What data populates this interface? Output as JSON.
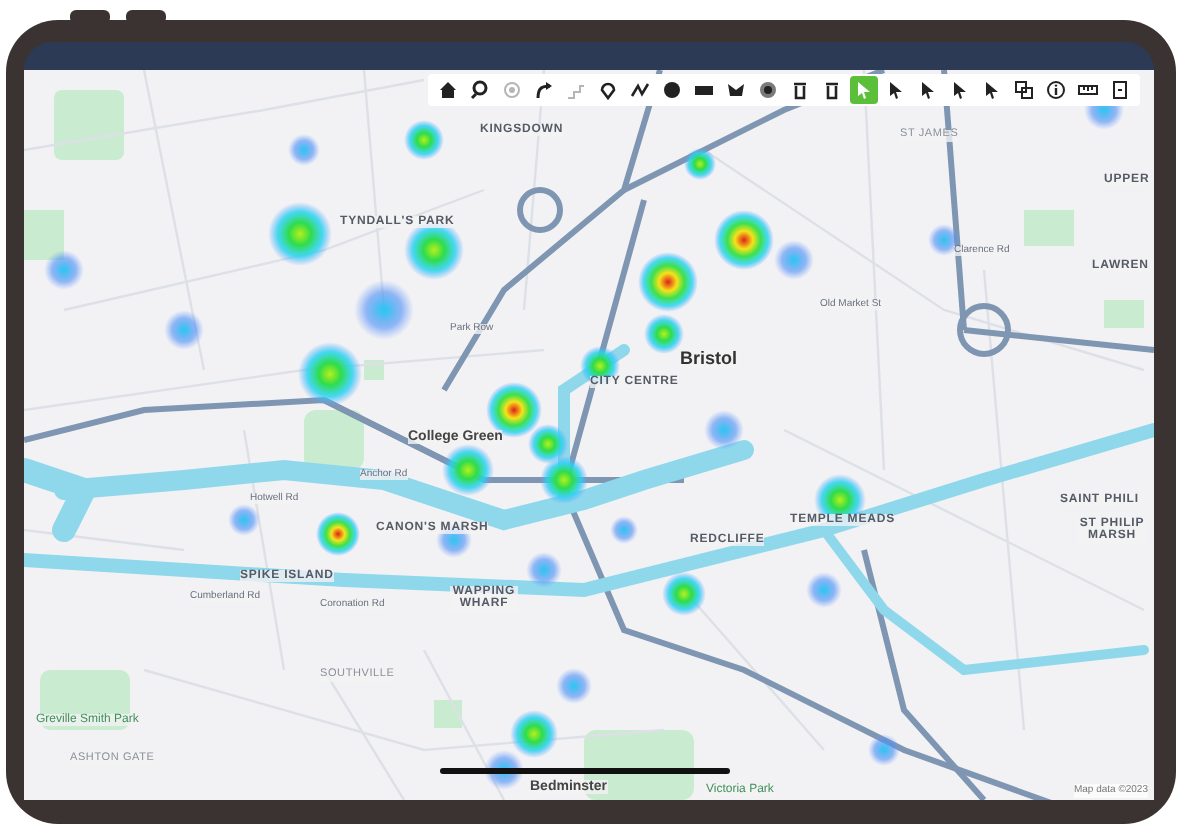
{
  "toolbar": {
    "tools": [
      {
        "kind": "home",
        "selected": false,
        "disabled": false
      },
      {
        "kind": "pin-search",
        "selected": false,
        "disabled": false
      },
      {
        "kind": "locate",
        "selected": false,
        "disabled": true
      },
      {
        "kind": "redo",
        "selected": false,
        "disabled": false
      },
      {
        "kind": "steps",
        "selected": false,
        "disabled": true
      },
      {
        "kind": "marker",
        "selected": false,
        "disabled": false
      },
      {
        "kind": "polyline",
        "selected": false,
        "disabled": false
      },
      {
        "kind": "circle",
        "selected": false,
        "disabled": false
      },
      {
        "kind": "rectangle",
        "selected": false,
        "disabled": false
      },
      {
        "kind": "polygon",
        "selected": false,
        "disabled": false
      },
      {
        "kind": "circle-marker",
        "selected": false,
        "disabled": false
      },
      {
        "kind": "trash",
        "selected": false,
        "disabled": false
      },
      {
        "kind": "trash",
        "selected": false,
        "disabled": false
      },
      {
        "kind": "pointer",
        "selected": true,
        "disabled": false
      },
      {
        "kind": "pointer",
        "selected": false,
        "disabled": false
      },
      {
        "kind": "pointer",
        "selected": false,
        "disabled": false
      },
      {
        "kind": "pointer",
        "selected": false,
        "disabled": false
      },
      {
        "kind": "pointer",
        "selected": false,
        "disabled": false
      },
      {
        "kind": "layers",
        "selected": false,
        "disabled": false
      },
      {
        "kind": "info",
        "selected": false,
        "disabled": false
      },
      {
        "kind": "ruler",
        "selected": false,
        "disabled": false
      },
      {
        "kind": "export",
        "selected": false,
        "disabled": false
      }
    ]
  },
  "map": {
    "places": [
      {
        "kind": "district",
        "text": "KINGSDOWN"
      },
      {
        "kind": "district",
        "text": "TYNDALL'S PARK"
      },
      {
        "kind": "city",
        "text": "Bristol"
      },
      {
        "kind": "district",
        "text": "CITY CENTRE"
      },
      {
        "kind": "landmark",
        "text": "College Green"
      },
      {
        "kind": "district",
        "text": "CANON'S MARSH"
      },
      {
        "kind": "district",
        "text": "SPIKE ISLAND"
      },
      {
        "kind": "district",
        "text": "WAPPING WHARF"
      },
      {
        "kind": "district",
        "text": "REDCLIFFE"
      },
      {
        "kind": "district",
        "text": "TEMPLE MEADS"
      },
      {
        "kind": "minor",
        "text": "ST JAMES"
      },
      {
        "kind": "district",
        "text": "UPPER"
      },
      {
        "kind": "district",
        "text": "LAWREN"
      },
      {
        "kind": "district",
        "text": "SAINT PHILI"
      },
      {
        "kind": "district",
        "text": "ST PHILIP MARSH"
      },
      {
        "kind": "minor",
        "text": "SOUTHVILLE"
      },
      {
        "kind": "minor",
        "text": "ASHTON GATE"
      },
      {
        "kind": "park",
        "text": "Greville Smith Park"
      },
      {
        "kind": "landmark",
        "text": "Bedminster"
      },
      {
        "kind": "park",
        "text": "Victoria Park"
      },
      {
        "kind": "road",
        "text": "Anchor Rd"
      },
      {
        "kind": "road",
        "text": "Hotwell Rd"
      },
      {
        "kind": "road",
        "text": "Coronation Rd"
      },
      {
        "kind": "road",
        "text": "Cumberland Rd"
      },
      {
        "kind": "road",
        "text": "Clarence Rd"
      },
      {
        "kind": "road",
        "text": "Old Market St"
      },
      {
        "kind": "road",
        "text": "Park Row"
      }
    ],
    "attribution": "Map data ©2023"
  }
}
